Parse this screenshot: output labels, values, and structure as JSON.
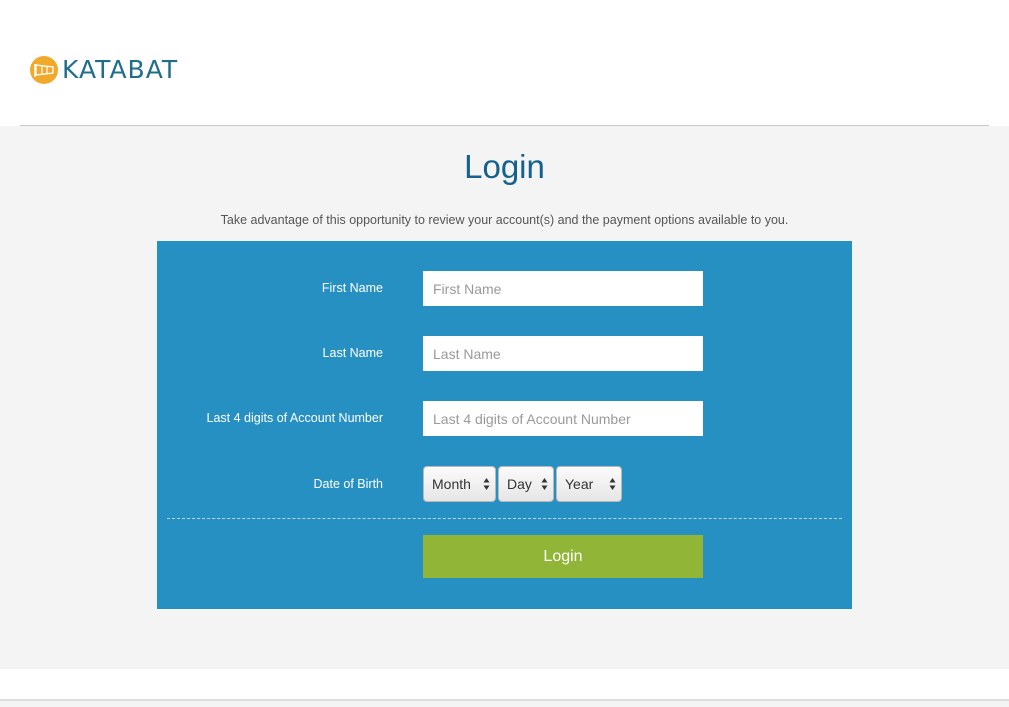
{
  "brand": {
    "name": "KATABAT",
    "logo_icon": "windsock-icon",
    "colors": {
      "brand_blue": "#1f6f8b",
      "brand_orange": "#f0a92b"
    }
  },
  "page": {
    "title": "Login",
    "subtitle": "Take advantage of this opportunity to review your account(s) and the payment options available to you."
  },
  "form": {
    "panel_color": "#2790c2",
    "first_name": {
      "label": "First Name",
      "placeholder": "First Name",
      "value": ""
    },
    "last_name": {
      "label": "Last Name",
      "placeholder": "Last Name",
      "value": ""
    },
    "account": {
      "label": "Last 4 digits of Account Number",
      "placeholder": "Last 4 digits of Account Number",
      "value": ""
    },
    "dob": {
      "label": "Date of Birth",
      "month": "Month",
      "day": "Day",
      "year": "Year"
    },
    "submit_label": "Login",
    "submit_color": "#90b537"
  }
}
